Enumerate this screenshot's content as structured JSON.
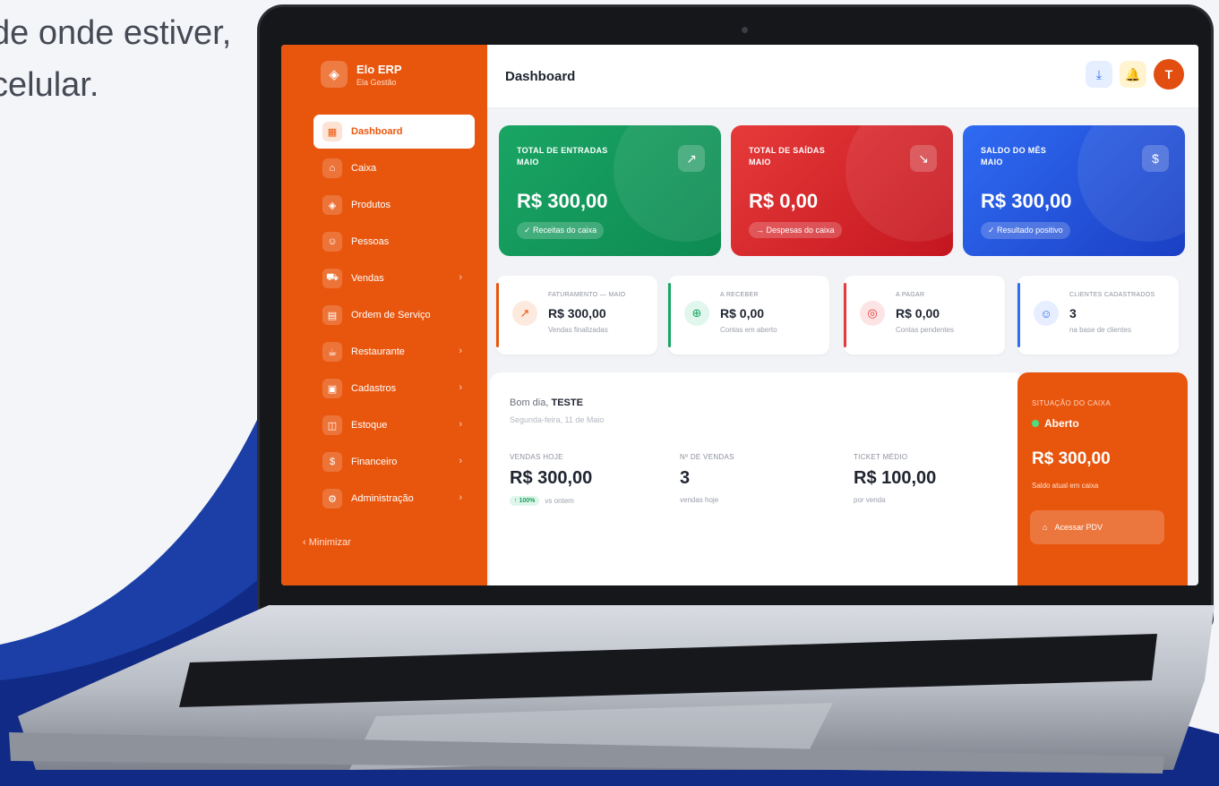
{
  "hero": {
    "line1": "de onde estiver,",
    "line2": "celular."
  },
  "colors": {
    "accent": "#e8560e",
    "green": "#1aa564",
    "red": "#e63a3a",
    "blue": "#2f6bf3",
    "wave": "#1b3fa6"
  },
  "app": {
    "name": "Elo ERP",
    "subtitle": "Ela Gestão"
  },
  "sidebar": {
    "items": [
      {
        "label": "Dashboard",
        "icon": "grid-icon",
        "glyph": "▦",
        "active": true,
        "chevron": false
      },
      {
        "label": "Caixa",
        "icon": "cash-register-icon",
        "glyph": "⌂",
        "active": false,
        "chevron": false
      },
      {
        "label": "Produtos",
        "icon": "package-icon",
        "glyph": "◈",
        "active": false,
        "chevron": false
      },
      {
        "label": "Pessoas",
        "icon": "users-icon",
        "glyph": "☺",
        "active": false,
        "chevron": false
      },
      {
        "label": "Vendas",
        "icon": "cart-icon",
        "glyph": "⛟",
        "active": false,
        "chevron": true
      },
      {
        "label": "Ordem de Serviço",
        "icon": "clipboard-icon",
        "glyph": "▤",
        "active": false,
        "chevron": false
      },
      {
        "label": "Restaurante",
        "icon": "cup-icon",
        "glyph": "☕",
        "active": false,
        "chevron": true
      },
      {
        "label": "Cadastros",
        "icon": "folder-icon",
        "glyph": "▣",
        "active": false,
        "chevron": true
      },
      {
        "label": "Estoque",
        "icon": "box-icon",
        "glyph": "◫",
        "active": false,
        "chevron": true
      },
      {
        "label": "Financeiro",
        "icon": "dollar-icon",
        "glyph": "$",
        "active": false,
        "chevron": true
      },
      {
        "label": "Administração",
        "icon": "settings-icon",
        "glyph": "⚙",
        "active": false,
        "chevron": true
      }
    ],
    "minimize": "‹  Minimizar"
  },
  "header": {
    "title": "Dashboard",
    "avatar": "T"
  },
  "big_cards": [
    {
      "label": "TOTAL DE ENTRADAS",
      "period": "MAIO",
      "value": "R$ 300,00",
      "chip": "✓ Receitas do caixa",
      "icon": "trend-up-icon",
      "glyph": "↗"
    },
    {
      "label": "TOTAL DE SAÍDAS",
      "period": "MAIO",
      "value": "R$ 0,00",
      "chip": "→ Despesas do caixa",
      "icon": "trend-down-icon",
      "glyph": "↘"
    },
    {
      "label": "SALDO DO MÊS",
      "period": "MAIO",
      "value": "R$ 300,00",
      "chip": "✓ Resultado positivo",
      "icon": "dollar-icon",
      "glyph": "$"
    }
  ],
  "small_cards": [
    {
      "label": "FATURAMENTO — MAIO",
      "value": "R$ 300,00",
      "sub": "Vendas finalizadas",
      "icon": "trend-up-icon",
      "glyph": "↗",
      "color": "#e8560e",
      "tint": "#fdeade"
    },
    {
      "label": "A RECEBER",
      "value": "R$ 0,00",
      "sub": "Contas em aberto",
      "icon": "arrow-circle-up-icon",
      "glyph": "⊕",
      "color": "#1aa564",
      "tint": "#e1f6ec"
    },
    {
      "label": "A PAGAR",
      "value": "R$ 0,00",
      "sub": "Contas pendentes",
      "icon": "alert-circle-icon",
      "glyph": "◎",
      "color": "#e63a3a",
      "tint": "#fde4e4"
    },
    {
      "label": "CLIENTES CADASTRADOS",
      "value": "3",
      "sub": "na base de clientes",
      "icon": "users-icon",
      "glyph": "☺",
      "color": "#2f6bf3",
      "tint": "#e6eeff"
    }
  ],
  "summary": {
    "greeting": "Bom dia,",
    "user": "TESTE",
    "date": "Segunda-feira, 11 de Maio",
    "metrics": [
      {
        "label": "VENDAS HOJE",
        "value": "R$ 300,00",
        "badge": "↑ 100%",
        "sub": "vs ontem"
      },
      {
        "label": "Nº DE VENDAS",
        "value": "3",
        "badge": "",
        "sub": "vendas hoje"
      },
      {
        "label": "TICKET MÉDIO",
        "value": "R$ 100,00",
        "badge": "",
        "sub": "por venda"
      }
    ]
  },
  "cash": {
    "label": "SITUAÇÃO DO CAIXA",
    "status": "Aberto",
    "value": "R$ 300,00",
    "sub": "Saldo atual em caixa",
    "button": "Acessar PDV"
  }
}
